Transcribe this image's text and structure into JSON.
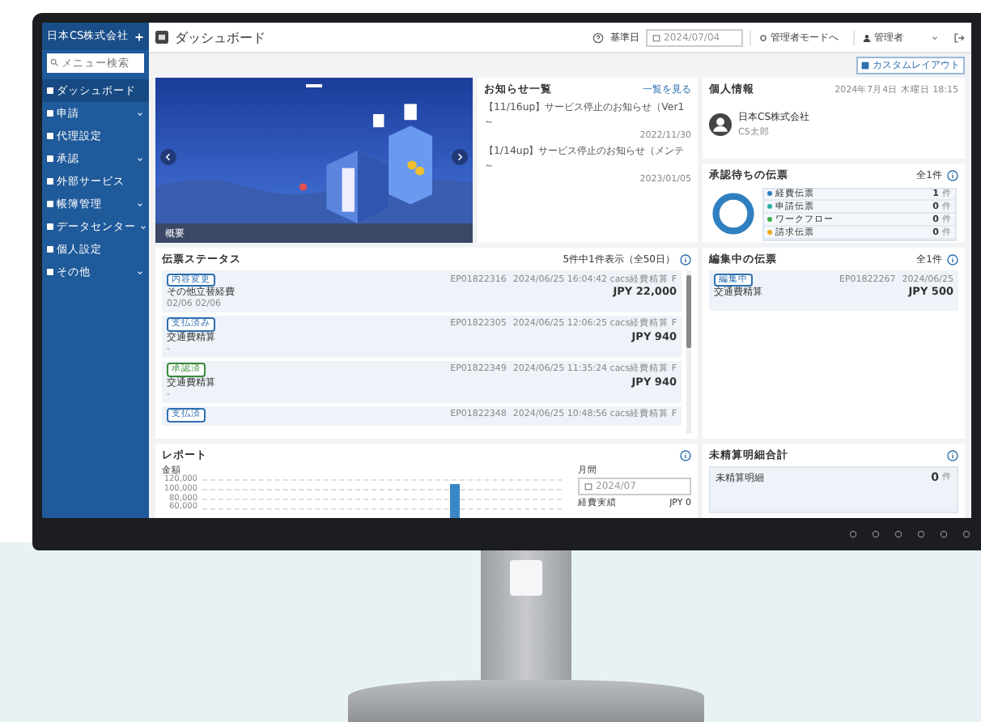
{
  "sidebar": {
    "company": "日本CS株式会社",
    "search_placeholder": "メニュー検索",
    "items": [
      {
        "label": "ダッシュボード",
        "kind": "link",
        "selected": true
      },
      {
        "label": "申請",
        "kind": "group",
        "selected": false
      },
      {
        "label": "代理設定",
        "kind": "link",
        "selected": false
      },
      {
        "label": "承認",
        "kind": "group",
        "selected": false
      },
      {
        "label": "外部サービス",
        "kind": "link",
        "selected": false
      },
      {
        "label": "帳簿管理",
        "kind": "group",
        "selected": false
      },
      {
        "label": "データセンター",
        "kind": "group",
        "selected": false
      },
      {
        "label": "個人設定",
        "kind": "link",
        "selected": false
      },
      {
        "label": "その他",
        "kind": "group",
        "selected": false
      }
    ]
  },
  "header": {
    "title": "ダッシュボード",
    "date_label": "基準日",
    "date": "2024/07/04",
    "admin_mode": "管理者モードへ",
    "user": "管理者"
  },
  "custom_layout_button": "カスタムレイアウト",
  "carousel": {
    "caption": "概要"
  },
  "notices": {
    "title": "お知らせ一覧",
    "link": "一覧を見る",
    "items": [
      {
        "text": "【11/16up】サービス停止のお知らせ（Ver1～",
        "date": "2022/11/30"
      },
      {
        "text": "【1/14up】サービス停止のお知らせ（メンテ～",
        "date": "2023/01/05"
      }
    ]
  },
  "profile": {
    "title": "個人情報",
    "datetime": "2024年7月4日 木曜日 18:15",
    "name": "日本CS株式会社",
    "sub": "CS太郎"
  },
  "approvals": {
    "title": "承認待ちの伝票",
    "count": "全1件",
    "items": [
      {
        "label": "経費伝票",
        "count": "1",
        "unit": "件",
        "color": "#2f7fc1"
      },
      {
        "label": "申請伝票",
        "count": "0",
        "unit": "件",
        "color": "#2ab0a8"
      },
      {
        "label": "ワークフロー",
        "count": "0",
        "unit": "件",
        "color": "#3fae4a"
      },
      {
        "label": "請求伝票",
        "count": "0",
        "unit": "件",
        "color": "#f0a820"
      }
    ]
  },
  "status": {
    "title": "伝票ステータス",
    "summary": "5件中1件表示（全50日）",
    "cards": [
      {
        "badge": "内容変更",
        "color": "#2f6fb0",
        "number": "EP01822316",
        "meta": "2024/06/25 16:04:42 cacs経費精算 F",
        "title": "その他立替経費",
        "amount": "JPY 22,000",
        "note": "02/06  02/06"
      },
      {
        "badge": "支払済み",
        "color": "#2f6fb0",
        "number": "EP01822305",
        "meta": "2024/06/25 12:06:25 cacs経費精算 F",
        "title": "交通費精算",
        "amount": "JPY 940",
        "note": "-"
      },
      {
        "badge": "承認済",
        "color": "#3a8a3a",
        "number": "EP01822349",
        "meta": "2024/06/25 11:35:24 cacs経費精算 F",
        "title": "交通費精算",
        "amount": "JPY 940",
        "note": "-"
      },
      {
        "badge": "支払済",
        "color": "#2f6fb0",
        "number": "EP01822348",
        "meta": "2024/06/25 10:48:56 cacs経費精算 F"
      }
    ]
  },
  "editing": {
    "title": "編集中の伝票",
    "count": "全1件",
    "cards": [
      {
        "badge": "編集中",
        "color": "#2f6fb0",
        "number": "EP01822267",
        "meta": "2024/06/25",
        "title": "交通費精算",
        "amount": "JPY 500"
      }
    ]
  },
  "report": {
    "title": "レポート",
    "axis_title": "金額",
    "axis_labels": [
      "120,000",
      "100,000",
      "80,000",
      "60,000"
    ],
    "period_label": "月間",
    "period": "2024/07",
    "total_label": "経費実績",
    "total": "JPY 0"
  },
  "unsettled": {
    "title": "未精算明細合計",
    "label": "未精算明細",
    "count": "0",
    "unit": "件"
  }
}
